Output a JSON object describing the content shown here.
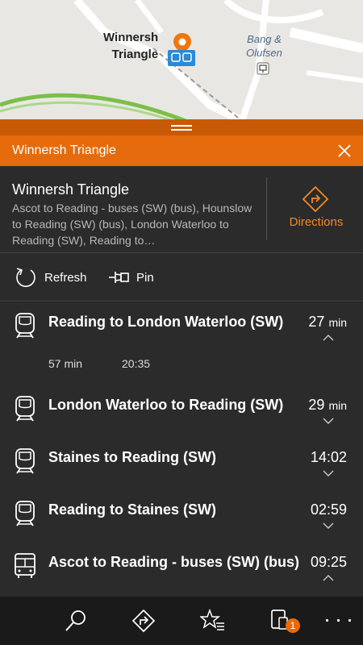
{
  "map": {
    "stop_label_line1": "Winnersh",
    "stop_label_line2": "Triangle",
    "poi_line1": "Bang &",
    "poi_line2": "Olufsen",
    "pin_color": "#f0760f",
    "icon_pin": "map-pin-icon",
    "icon_train": "train-stop-icon",
    "icon_store": "store-icon"
  },
  "header": {
    "title": "Winnersh Triangle",
    "close_icon": "close-icon",
    "accent_color": "#e56b0c"
  },
  "stop": {
    "name": "Winnersh Triangle",
    "description": "Ascot to Reading - buses (SW) (bus), Hounslow to Reading (SW) (bus), London Waterloo to Reading (SW), Reading to…",
    "directions_label": "Directions",
    "directions_icon": "directions-icon"
  },
  "actions": {
    "refresh_label": "Refresh",
    "pin_label": "Pin"
  },
  "routes": [
    {
      "name": "Reading to London Waterloo (SW)",
      "time": "27",
      "unit": "min",
      "icon": "train-icon",
      "expanded": true,
      "details": [
        "57 min",
        "20:35"
      ]
    },
    {
      "name": "London Waterloo to Reading (SW)",
      "time": "29",
      "unit": "min",
      "icon": "train-icon",
      "expanded": false
    },
    {
      "name": "Staines to Reading (SW)",
      "time": "14:02",
      "unit": "",
      "icon": "train-icon",
      "expanded": false
    },
    {
      "name": "Reading to Staines (SW)",
      "time": "02:59",
      "unit": "",
      "icon": "train-icon",
      "expanded": false
    },
    {
      "name": "Ascot to Reading - buses (SW) (bus)",
      "time": "09:25",
      "unit": "",
      "icon": "bus-icon",
      "expanded": true
    }
  ],
  "appbar": {
    "items": [
      "search-icon",
      "directions-icon",
      "favorites-icon",
      "devices-icon",
      "more-icon"
    ],
    "badge_count": "1"
  }
}
